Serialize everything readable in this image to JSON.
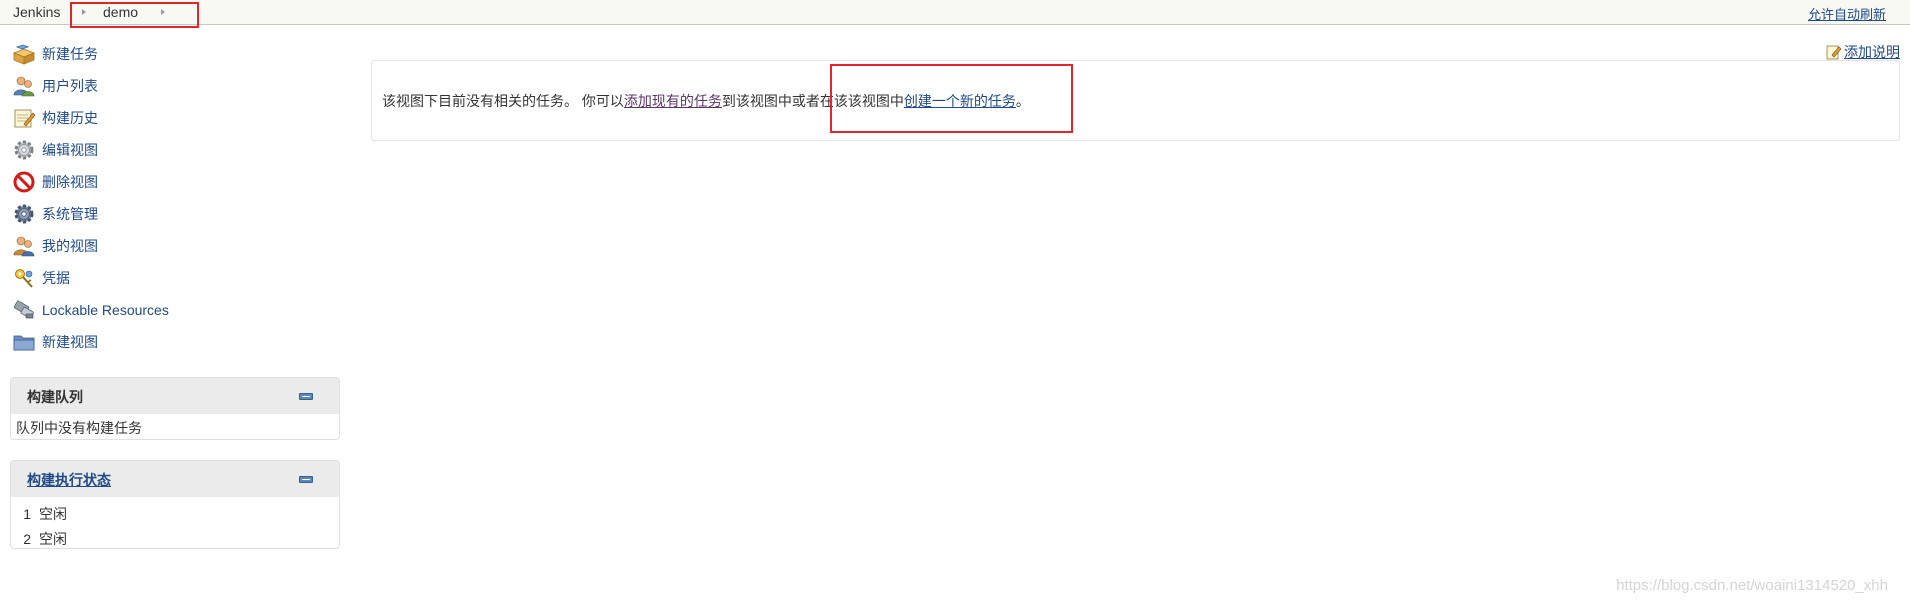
{
  "breadcrumb": {
    "items": [
      "Jenkins",
      "demo"
    ]
  },
  "header": {
    "auto_refresh_label": "允许自动刷新"
  },
  "sidebar": {
    "tasks": [
      {
        "label": "新建任务",
        "icon": "new-package-icon"
      },
      {
        "label": "用户列表",
        "icon": "users-icon"
      },
      {
        "label": "构建历史",
        "icon": "notepad-icon"
      },
      {
        "label": "编辑视图",
        "icon": "gear-icon"
      },
      {
        "label": "删除视图",
        "icon": "no-entry-icon"
      },
      {
        "label": "系统管理",
        "icon": "gear-icon"
      },
      {
        "label": "我的视图",
        "icon": "user-views-icon"
      },
      {
        "label": "凭据",
        "icon": "credentials-icon"
      },
      {
        "label": "Lockable Resources",
        "icon": "usb-lock-icon"
      },
      {
        "label": "新建视图",
        "icon": "folder-icon"
      }
    ]
  },
  "build_queue": {
    "title": "构建队列",
    "empty_text": "队列中没有构建任务"
  },
  "executor_status": {
    "title": "构建执行状态",
    "executors": [
      {
        "number": "1",
        "state": "空闲"
      },
      {
        "number": "2",
        "state": "空闲"
      }
    ]
  },
  "main": {
    "add_description_label": "添加说明",
    "message_prefix": "该视图下目前没有相关的任务。 你可以",
    "link_add_existing": "添加现有的任务",
    "message_middle": "到该视图中或者在该该视图中",
    "link_create_new": "创建一个新的任务",
    "message_suffix": "。"
  },
  "watermark": "https://blog.csdn.net/woaini1314520_xhh",
  "colors": {
    "link": "#204a87",
    "visited_link": "#5c3566",
    "highlight_box": "#e0262c",
    "topbar_bg": "#f9f9f4",
    "pane_header_bg": "#ebebeb"
  }
}
